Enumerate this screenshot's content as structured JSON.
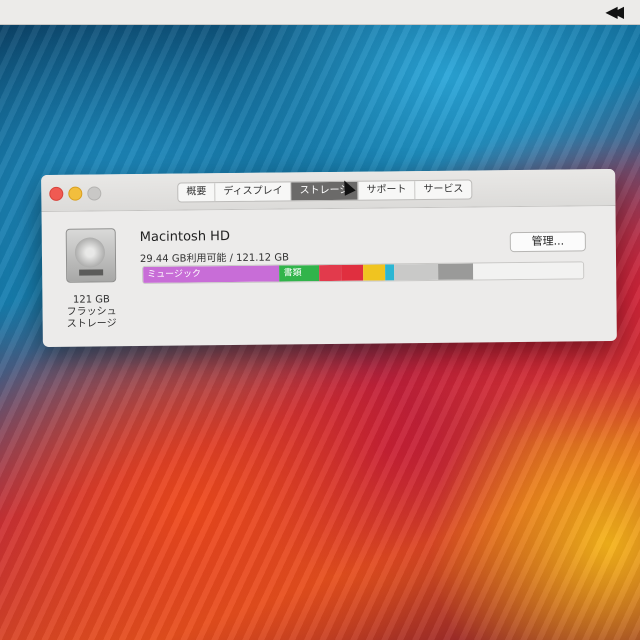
{
  "menubar": {
    "icon": "fast-rewind-icon",
    "glyph": "◀◀"
  },
  "window": {
    "tabs": [
      {
        "label": "概要"
      },
      {
        "label": "ディスプレイ"
      },
      {
        "label": "ストレージ",
        "active": true
      },
      {
        "label": "サポート"
      },
      {
        "label": "サービス"
      }
    ],
    "disk": {
      "name": "Macintosh HD",
      "usage": "29.44 GB利用可能 / 121.12 GB",
      "capacity_line1": "121 GB",
      "capacity_line2": "フラッシュ",
      "capacity_line3": "ストレージ",
      "manage_label": "管理..."
    },
    "storage_bar": {
      "segments": [
        {
          "label": "ミュージック",
          "fraction": 0.31,
          "color": "#c86dd7"
        },
        {
          "label": "書類",
          "fraction": 0.09,
          "color": "#31b44b"
        },
        {
          "label": "",
          "fraction": 0.05,
          "color": "#e23a4c"
        },
        {
          "label": "",
          "fraction": 0.05,
          "color": "#e02f3f"
        },
        {
          "label": "",
          "fraction": 0.05,
          "color": "#f0c420"
        },
        {
          "label": "",
          "fraction": 0.02,
          "color": "#2bb6d3"
        },
        {
          "label": "",
          "fraction": 0.1,
          "color": "#c9c9c8"
        },
        {
          "label": "",
          "fraction": 0.08,
          "color": "#9a9a99"
        },
        {
          "label": "",
          "fraction": 0.25,
          "color": "#f2f2f1"
        }
      ]
    }
  }
}
